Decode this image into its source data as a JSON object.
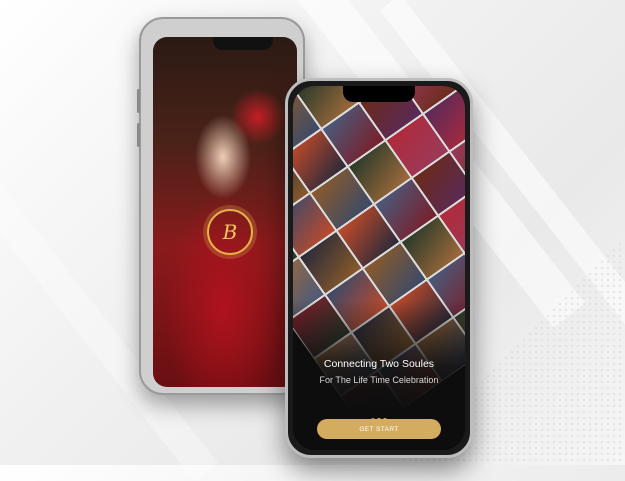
{
  "background": {
    "color": "#eeeeee"
  },
  "back_phone": {
    "logo_letter": "B",
    "logo_color": "#e6b24a"
  },
  "front_phone": {
    "tagline_title": "Connecting Two Soules",
    "tagline_subtitle": "For The Life Time Celebration",
    "pager_count": 3,
    "pager_active_index": 0,
    "cta_label": "GET START",
    "cta_color": "#d4ac60",
    "pager_active_color": "#e36a8c",
    "pager_inactive_color": "#d9a84d"
  }
}
